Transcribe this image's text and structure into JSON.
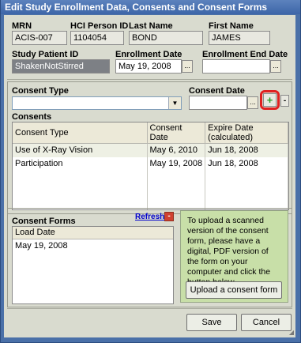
{
  "window": {
    "title": "Edit Study Enrollment Data, Consents and Consent Forms"
  },
  "patient": {
    "mrn_label": "MRN",
    "mrn_value": "ACIS-007",
    "hci_label": "HCI Person ID",
    "hci_value": "1104054",
    "last_label": "Last Name",
    "last_value": "BOND",
    "first_label": "First Name",
    "first_value": "JAMES"
  },
  "enrollment": {
    "study_id_label": "Study Patient ID",
    "study_id_value": "ShakenNotStirred",
    "date_label": "Enrollment Date",
    "date_value": "May 19, 2008",
    "end_label": "Enrollment End Date",
    "end_value": ""
  },
  "consent_entry": {
    "type_label": "Consent Type",
    "type_value": "",
    "date_label": "Consent Date",
    "date_value": "",
    "ellipsis": "...",
    "add_glyph": "+",
    "remove_glyph": "-"
  },
  "consents": {
    "title": "Consents",
    "columns": [
      "Consent Type",
      "Consent Date",
      "Expire Date (calculated)"
    ],
    "rows": [
      [
        "Use of X-Ray Vision",
        "May 6, 2010",
        "Jun 18, 2008"
      ],
      [
        "Participation",
        "May 19, 2008",
        "Jun 18, 2008"
      ]
    ]
  },
  "consent_forms": {
    "title": "Consent Forms",
    "refresh_label": "Refresh",
    "remove_glyph": "-",
    "column": "Load Date",
    "rows": [
      "May 19, 2008"
    ],
    "upload_text": "To upload a scanned version of the consent form, please have a digital, PDF version of the form on your computer and click the button below.",
    "upload_button": "Upload a consent form"
  },
  "footer": {
    "save_label": "Save",
    "cancel_label": "Cancel"
  },
  "colors": {
    "accent_ring": "#e02020",
    "add_icon": "#2a9a2a",
    "upload_panel": "#c8dfa8",
    "title_bar": "#3d66a8"
  }
}
